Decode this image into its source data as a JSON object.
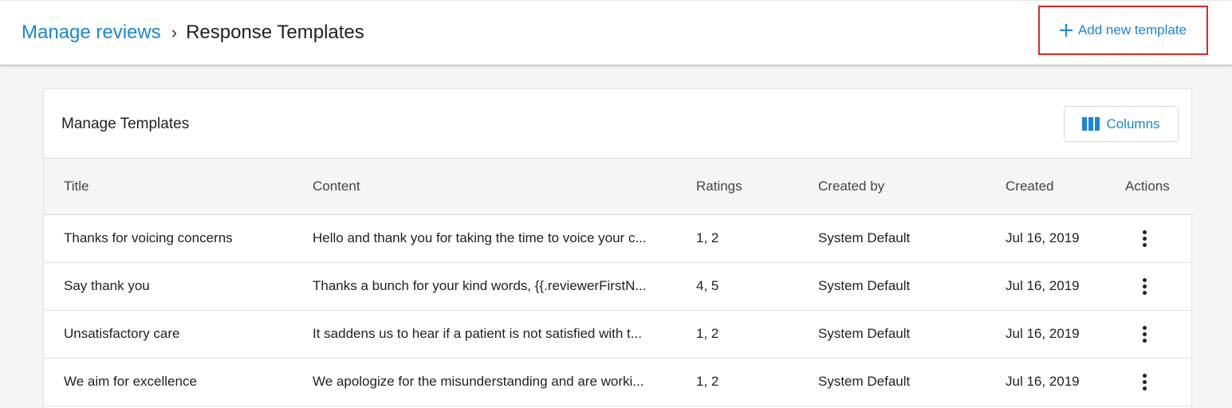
{
  "header": {
    "breadcrumb_link": "Manage reviews",
    "breadcrumb_separator": "›",
    "breadcrumb_current": "Response Templates",
    "add_button_label": "Add new template",
    "add_button_icon": "plus-icon"
  },
  "card": {
    "title": "Manage Templates",
    "columns_button_label": "Columns",
    "columns_button_icon": "columns-icon"
  },
  "table": {
    "columns": [
      "Title",
      "Content",
      "Ratings",
      "Created by",
      "Created",
      "Actions"
    ],
    "rows": [
      {
        "title": "Thanks for voicing concerns",
        "content": "Hello and thank you for taking the time to voice your c...",
        "ratings": "1, 2",
        "created_by": "System Default",
        "created": "Jul 16, 2019"
      },
      {
        "title": "Say thank you",
        "content": "Thanks a bunch for your kind words, {{.reviewerFirstN...",
        "ratings": "4, 5",
        "created_by": "System Default",
        "created": "Jul 16, 2019"
      },
      {
        "title": "Unsatisfactory care",
        "content": "It saddens us to hear if a patient is not satisfied with t...",
        "ratings": "1, 2",
        "created_by": "System Default",
        "created": "Jul 16, 2019"
      },
      {
        "title": "We aim for excellence",
        "content": "We apologize for the misunderstanding and are worki...",
        "ratings": "1, 2",
        "created_by": "System Default",
        "created": "Jul 16, 2019"
      }
    ]
  },
  "colors": {
    "accent": "#1a86d9",
    "highlight_border": "#e0262b",
    "page_background": "#f5f5f5"
  }
}
